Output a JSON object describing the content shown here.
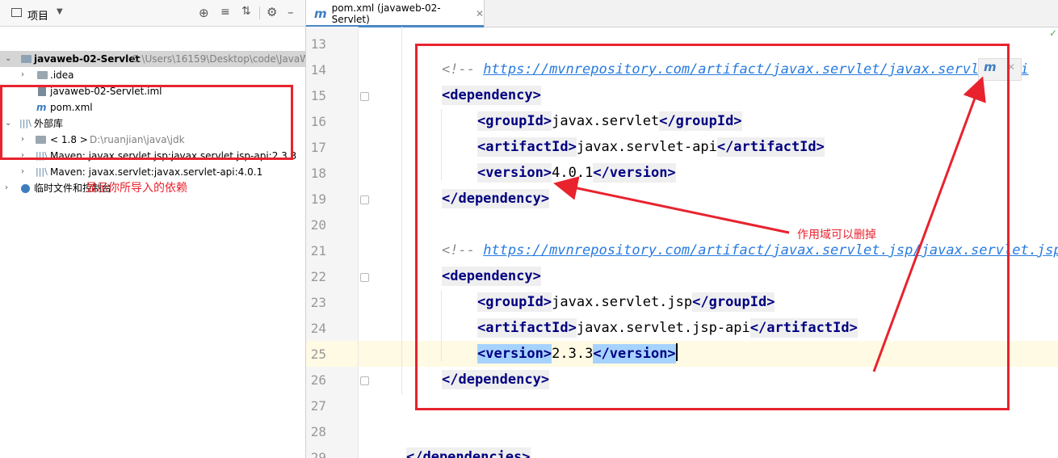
{
  "project_panel": {
    "title": "项目",
    "tree": [
      {
        "label": "javaweb-02-Servlet",
        "path": "C:\\Users\\16159\\Desktop\\code\\JavaW"
      },
      {
        "label": ".idea"
      },
      {
        "label": "javaweb-02-Servlet.iml"
      },
      {
        "label": "pom.xml"
      },
      {
        "label": "外部库"
      },
      {
        "label": "< 1.8 >",
        "path": "D:\\ruanjian\\java\\jdk"
      },
      {
        "label": "Maven: javax.servlet.jsp:javax.servlet.jsp-api:2.3.3"
      },
      {
        "label": "Maven: javax.servlet:javax.servlet-api:4.0.1"
      },
      {
        "label": "临时文件和控制台"
      }
    ],
    "annotation": "显示你所导入的依赖"
  },
  "editor": {
    "tab_label": "pom.xml (javaweb-02-Servlet)",
    "tab_icon_letter": "m",
    "line_numbers": [
      "13",
      "14",
      "15",
      "16",
      "17",
      "18",
      "19",
      "20",
      "21",
      "22",
      "23",
      "24",
      "25",
      "26",
      "27",
      "28",
      "29"
    ],
    "lines": {
      "l14_open": "<!-- ",
      "l14_url": "https://mvnrepository.com/artifact/javax.servlet/javax.servlet-api",
      "l15": "<dependency>",
      "l16_open": "<groupId>",
      "l16_text": "javax.servlet",
      "l16_close": "</groupId>",
      "l17_open": "<artifactId>",
      "l17_text": "javax.servlet-api",
      "l17_close": "</artifactId>",
      "l18_open": "<version>",
      "l18_text": "4.0.1",
      "l18_close": "</version>",
      "l19": "</dependency>",
      "l21_open": "<!-- ",
      "l21_url": "https://mvnrepository.com/artifact/javax.servlet.jsp/javax.servlet.jsp-api",
      "l22": "<dependency>",
      "l23_open": "<groupId>",
      "l23_text": "javax.servlet.jsp",
      "l23_close": "</groupId>",
      "l24_open": "<artifactId>",
      "l24_text": "javax.servlet.jsp-api",
      "l24_close": "</artifactId>",
      "l25_open": "<version>",
      "l25_text": "2.3.3",
      "l25_close": "</version>",
      "l26": "</dependency>",
      "l29": "</dependencies>"
    },
    "annotation": "作用域可以删掉",
    "maven_badge": "m"
  },
  "colors": {
    "annotation_red": "#e8232e",
    "tag_blue": "#000080",
    "url_blue": "#287bde",
    "tab_accent": "#4a88c7"
  }
}
